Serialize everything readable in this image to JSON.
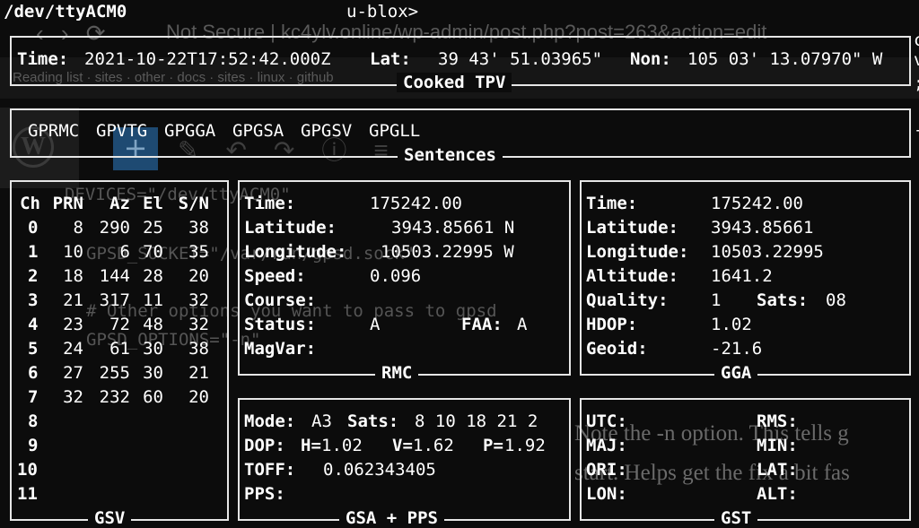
{
  "terminal": {
    "device": "/dev/ttyACM0",
    "receiver": "u-blox>",
    "right_edge": [
      "c",
      "v",
      ";",
      "-"
    ]
  },
  "background": {
    "address_bar": "Not Secure  |  kc4ylv.online/wp-admin/post.php?post=263&action=edit",
    "bookmarks": "Reading list  ·  sites  ·  other  ·  docs  ·  sites  ·  linux  ·  github",
    "config_lines": [
      "DEVICES=\"/dev/ttyACM0\"",
      "GPSD_SOCKET=\"/var/run/gpsd.sock\"",
      "# Other options you want to pass to gpsd",
      "GPSD_OPTIONS=\"-n\""
    ],
    "prose_lines": [
      "Note the -n option. This tells g",
      "start. Helps get the fix a bit fas"
    ]
  },
  "tpv": {
    "title": "Cooked TPV",
    "time_label": "Time:",
    "time_value": "2021-10-22T17:52:42.000Z",
    "lat_label": "Lat:",
    "lat_value": "39 43' 51.03965\"",
    "lon_label": "Non:",
    "lon_value": "105 03' 13.07970\" W"
  },
  "sentences": {
    "title": "Sentences",
    "list": [
      "GPRMC",
      "GPVTG",
      "GPGGA",
      "GPGSA",
      "GPGSV",
      "GPGLL"
    ]
  },
  "gsv": {
    "title": "GSV",
    "headers": [
      "Ch",
      "PRN",
      "Az",
      "El",
      "S/N"
    ],
    "rows": [
      [
        "0",
        "8",
        "290",
        "25",
        "38"
      ],
      [
        "1",
        "10",
        "6",
        "70",
        "35"
      ],
      [
        "2",
        "18",
        "144",
        "28",
        "20"
      ],
      [
        "3",
        "21",
        "317",
        "11",
        "32"
      ],
      [
        "4",
        "23",
        "72",
        "48",
        "32"
      ],
      [
        "5",
        "24",
        "61",
        "30",
        "38"
      ],
      [
        "6",
        "27",
        "255",
        "30",
        "21"
      ],
      [
        "7",
        "32",
        "232",
        "60",
        "20"
      ],
      [
        "8",
        "",
        "",
        "",
        ""
      ],
      [
        "9",
        "",
        "",
        "",
        ""
      ],
      [
        "10",
        "",
        "",
        "",
        ""
      ],
      [
        "11",
        "",
        "",
        "",
        ""
      ]
    ]
  },
  "rmc": {
    "title": "RMC",
    "time_label": "Time:",
    "time_value": "175242.00",
    "lat_label": "Latitude:",
    "lat_value": "3943.85661 N",
    "lon_label": "Longitude:",
    "lon_value": "10503.22995 W",
    "speed_label": "Speed:",
    "speed_value": "0.096",
    "course_label": "Course:",
    "course_value": "",
    "status_label": "Status:",
    "status_value": "A",
    "faa_label": "FAA:",
    "faa_value": "A",
    "magvar_label": "MagVar:",
    "magvar_value": ""
  },
  "gga": {
    "title": "GGA",
    "time_label": "Time:",
    "time_value": "175242.00",
    "lat_label": "Latitude:",
    "lat_value": "3943.85661",
    "lon_label": "Longitude:",
    "lon_value": "10503.22995",
    "alt_label": "Altitude:",
    "alt_value": "1641.2",
    "quality_label": "Quality:",
    "quality_value": "1",
    "sats_label": "Sats:",
    "sats_value": "08",
    "hdop_label": "HDOP:",
    "hdop_value": "1.02",
    "geoid_label": "Geoid:",
    "geoid_value": "-21.6"
  },
  "gsa": {
    "title": "GSA + PPS",
    "mode_label": "Mode:",
    "mode_value": "A3",
    "sats_label": "Sats:",
    "sats_value": "8 10 18 21 2",
    "dop_label": "DOP:",
    "h_label": "H=",
    "h_value": "1.02",
    "v_label": "V=",
    "v_value": "1.62",
    "p_label": "P=",
    "p_value": "1.92",
    "toff_label": "TOFF:",
    "toff_value": "0.062343405",
    "pps_label": "PPS:",
    "pps_value": ""
  },
  "gst": {
    "title": "GST",
    "utc_label": "UTC:",
    "rms_label": "RMS:",
    "maj_label": "MAJ:",
    "min_label": "MIN:",
    "ori_label": "ORI:",
    "lat_label": "LAT:",
    "lon_label": "LON:",
    "alt_label": "ALT:"
  }
}
